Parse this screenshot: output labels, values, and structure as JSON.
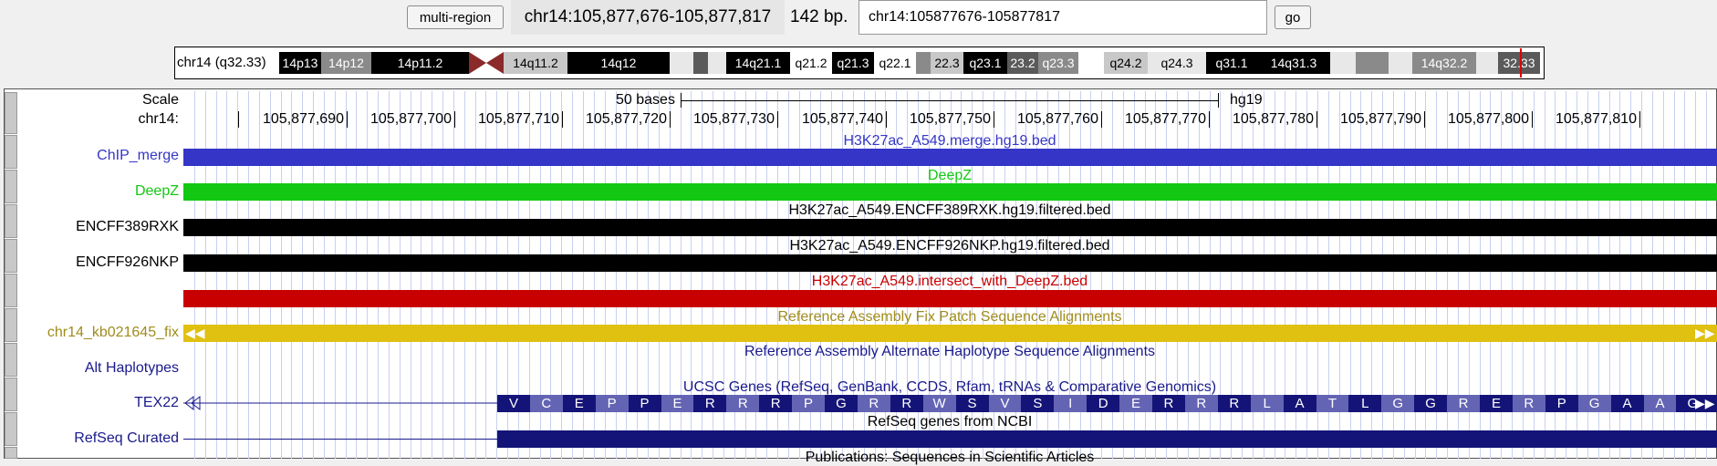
{
  "nav": {
    "multi_region_label": "multi-region",
    "position": "chr14:105,877,676-105,877,817",
    "size": "142 bp.",
    "search_value": "chr14:105877676-105877817",
    "go_label": "go"
  },
  "ideogram": {
    "label": "chr14 (q32.33)",
    "bands": [
      "14p13",
      "14p12",
      "14p11.2",
      "14q11.2",
      "14q12",
      "14q21.1",
      "q21.2",
      "q21.3",
      "q22.1",
      "22.3",
      "q23.1",
      "23.2",
      "q23.3",
      "q24.2",
      "q24.3",
      "q31.1",
      "14q31.3",
      "14q32.2",
      "32.33"
    ]
  },
  "scale": {
    "label": "Scale",
    "chrom_label": "chr14:",
    "bases_text": "50 bases",
    "assembly": "hg19",
    "coords": [
      "105,877,690",
      "105,877,700",
      "105,877,710",
      "105,877,720",
      "105,877,730",
      "105,877,740",
      "105,877,750",
      "105,877,760",
      "105,877,770",
      "105,877,780",
      "105,877,790",
      "105,877,800",
      "105,877,810"
    ]
  },
  "tracks": {
    "chip": {
      "label": "ChIP_merge",
      "title": "H3K27ac_A549.merge.hg19.bed",
      "color": "#3535c8"
    },
    "deepz": {
      "label": "DeepZ",
      "title": "DeepZ",
      "color": "#12c812"
    },
    "encff389": {
      "label": "ENCFF389RXK",
      "title": "H3K27ac_A549.ENCFF389RXK.hg19.filtered.bed",
      "color": "#000000"
    },
    "encff926": {
      "label": "ENCFF926NKP",
      "title": "H3K27ac_A549.ENCFF926NKP.hg19.filtered.bed",
      "color": "#000000"
    },
    "intersect": {
      "label": "",
      "title": "H3K27ac_A549.intersect_with_DeepZ.bed",
      "color": "#c80000"
    },
    "fix": {
      "label": "chr14_kb021645_fix",
      "title": "Reference Assembly Fix Patch Sequence Alignments",
      "color": "#e0c010"
    },
    "alt": {
      "label": "Alt Haplotypes",
      "title": "Reference Assembly Alternate Haplotype Sequence Alignments"
    },
    "ucsc": {
      "label": "TEX22",
      "title": "UCSC Genes (RefSeq, GenBank, CCDS, Rfam, tRNAs & Comparative Genomics)",
      "aa": [
        "V",
        "C",
        "E",
        "P",
        "P",
        "E",
        "R",
        "R",
        "R",
        "P",
        "G",
        "R",
        "R",
        "W",
        "S",
        "V",
        "S",
        "I",
        "D",
        "E",
        "R",
        "R",
        "R",
        "L",
        "A",
        "T",
        "L",
        "G",
        "G",
        "R",
        "E",
        "R",
        "P",
        "G",
        "A",
        "A",
        "G"
      ]
    },
    "refseq": {
      "label": "RefSeq Curated",
      "title": "RefSeq genes from NCBI"
    },
    "pubs": {
      "title": "Publications: Sequences in Scientific Articles"
    }
  }
}
